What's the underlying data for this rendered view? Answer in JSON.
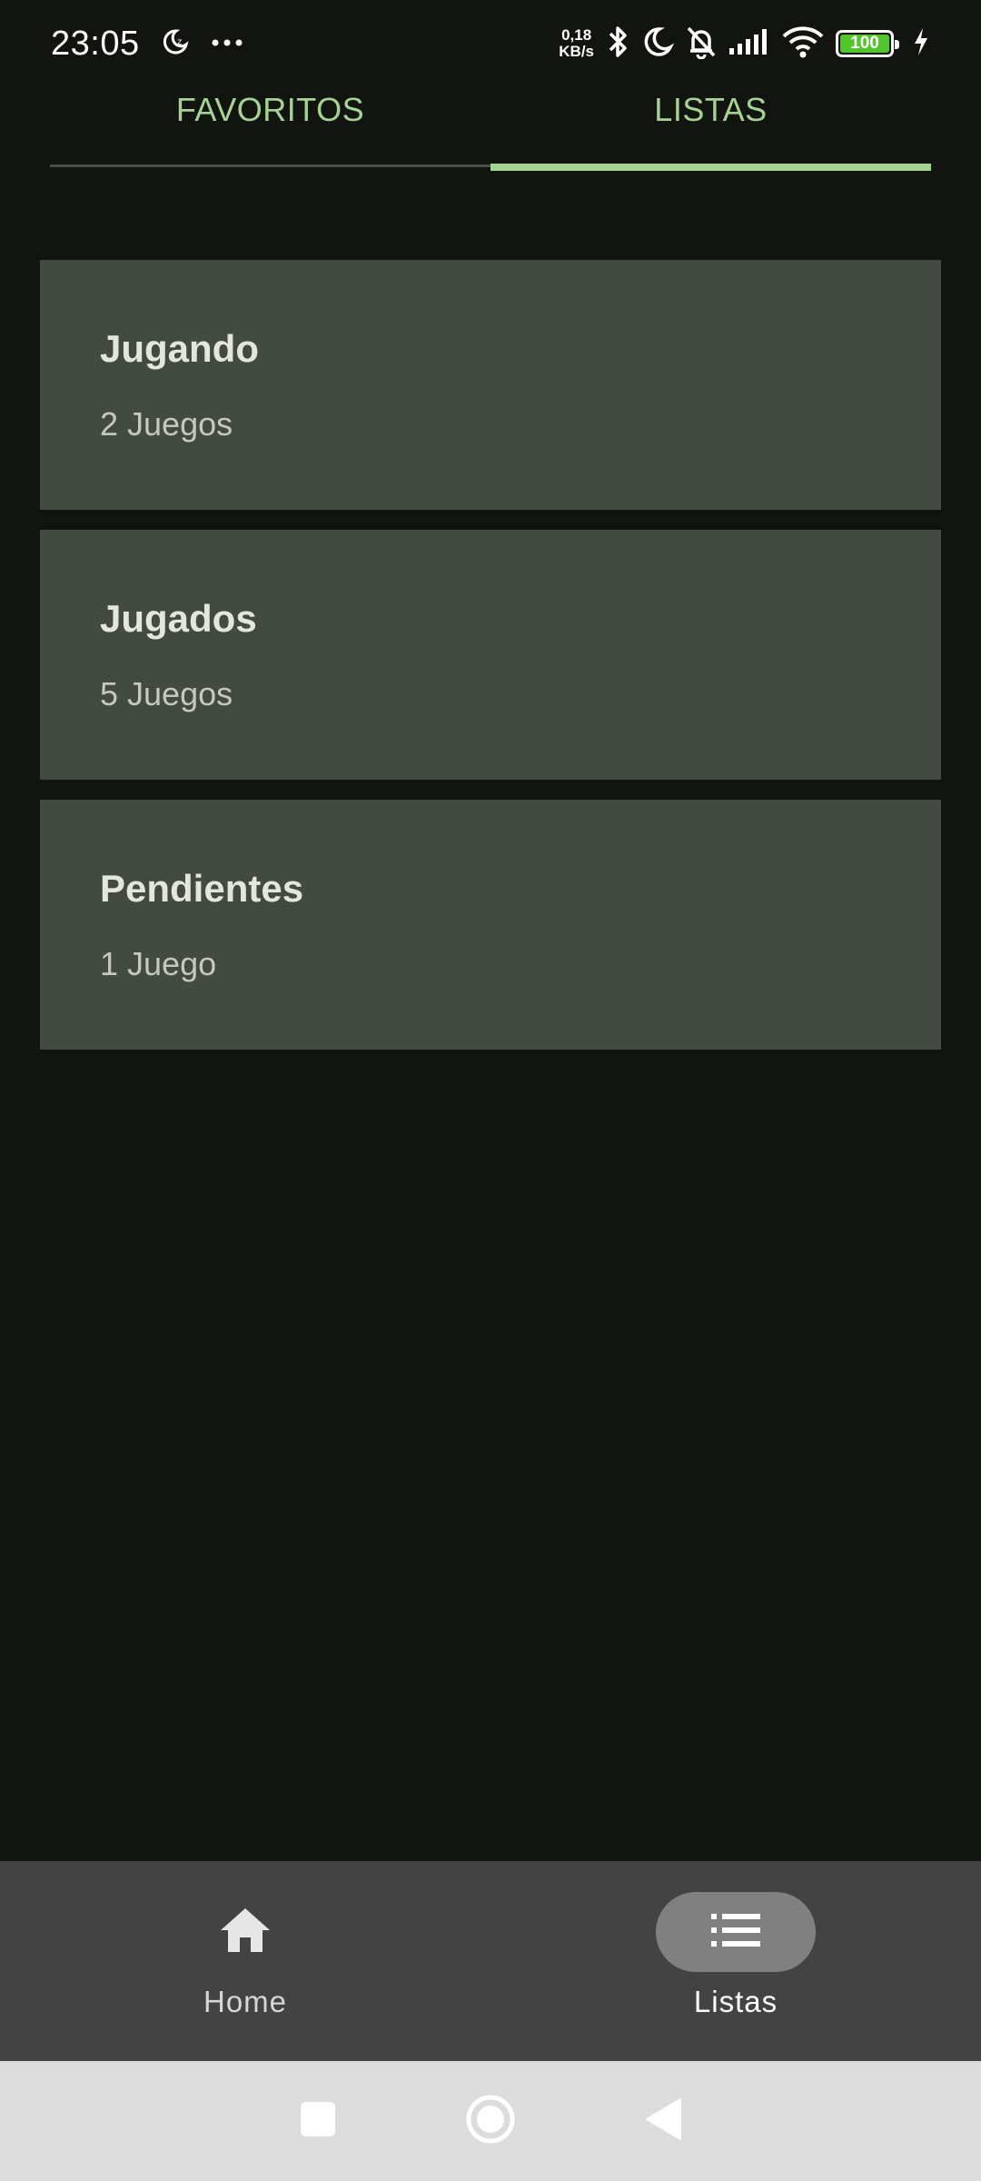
{
  "status_bar": {
    "time": "23:05",
    "net_speed_value": "0,18",
    "net_speed_unit": "KB/s",
    "battery": "100",
    "battery_color": "#4fc72a"
  },
  "tabs": [
    {
      "label": "FAVORITOS",
      "active": false
    },
    {
      "label": "LISTAS",
      "active": true
    }
  ],
  "lists": [
    {
      "title": "Jugando",
      "count": "2 Juegos"
    },
    {
      "title": "Jugados",
      "count": "5 Juegos"
    },
    {
      "title": "Pendientes",
      "count": "1 Juego"
    }
  ],
  "bottom_nav": {
    "items": [
      {
        "label": "Home",
        "icon": "home-icon",
        "active": false
      },
      {
        "label": "Listas",
        "icon": "list-icon",
        "active": true
      }
    ]
  },
  "system_nav": {
    "icons": [
      "recents-icon",
      "home-circle-icon",
      "back-icon"
    ]
  },
  "colors": {
    "background": "#121410",
    "accent": "#a6d394",
    "card": "#434a41",
    "bottom_nav": "#434343"
  }
}
